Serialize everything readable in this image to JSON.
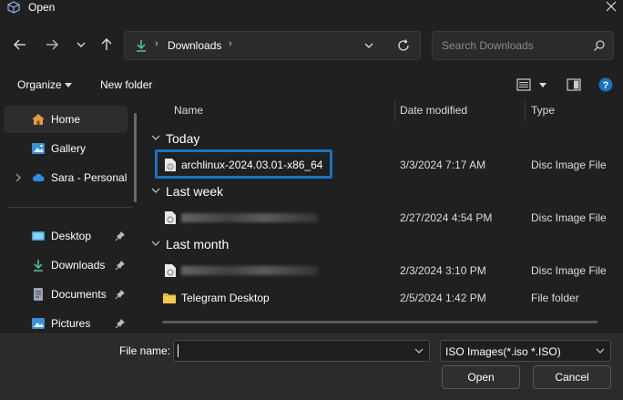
{
  "window": {
    "title": "Open"
  },
  "address": {
    "crumb": "Downloads"
  },
  "search": {
    "placeholder": "Search Downloads"
  },
  "toolbar": {
    "organize": "Organize",
    "new_folder": "New folder"
  },
  "sidebar": {
    "items": [
      {
        "label": "Home",
        "icon": "home-icon"
      },
      {
        "label": "Gallery",
        "icon": "gallery-icon"
      },
      {
        "label": "Sara - Personal",
        "icon": "cloud-icon"
      },
      {
        "label": "Desktop",
        "icon": "desktop-icon"
      },
      {
        "label": "Downloads",
        "icon": "download-icon"
      },
      {
        "label": "Documents",
        "icon": "documents-icon"
      },
      {
        "label": "Pictures",
        "icon": "pictures-icon"
      }
    ]
  },
  "columns": {
    "name": "Name",
    "date": "Date modified",
    "type": "Type"
  },
  "groups": {
    "today": {
      "label": "Today",
      "files": [
        {
          "name": "archlinux-2024.03.01-x86_64",
          "date": "3/3/2024 7:17 AM",
          "type": "Disc Image File"
        }
      ]
    },
    "last_week": {
      "label": "Last week",
      "files": [
        {
          "name": "en-...",
          "date": "2/27/2024 4:54 PM",
          "type": "Disc Image File"
        }
      ]
    },
    "last_month": {
      "label": "Last month",
      "files": [
        {
          "name": "pop...",
          "date": "2/3/2024 3:10 PM",
          "type": "Disc Image File"
        },
        {
          "name": "Telegram Desktop",
          "date": "2/5/2024 1:42 PM",
          "type": "File folder"
        }
      ]
    }
  },
  "bottom": {
    "file_name_label": "File name:",
    "file_name_value": "",
    "filter": "ISO Images(*.iso *.ISO)",
    "open": "Open",
    "cancel": "Cancel"
  },
  "colors": {
    "accent": "#1a72c4",
    "background": "#202020",
    "folder": "#e8b33a",
    "download_green": "#4cc28a"
  }
}
